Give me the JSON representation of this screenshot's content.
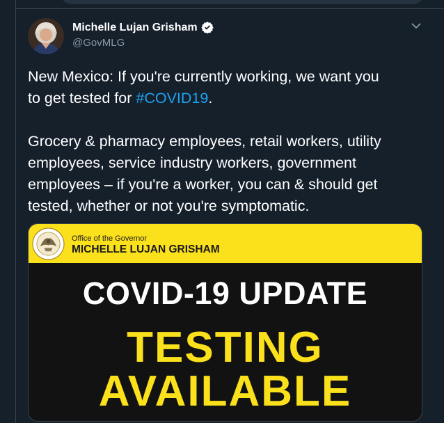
{
  "tweet": {
    "author_name": "Michelle Lujan Grisham",
    "author_handle": "@GovMLG",
    "line1_pre": "New Mexico: If you're currently working, we want you",
    "line2_pre": "to get tested for ",
    "hashtag": "#COVID19",
    "line2_post": ".",
    "para2": [
      "Grocery & pharmacy employees, retail workers, utility",
      "employees, service industry workers, government",
      "employees – if you're a worker, you can & should get",
      "tested, whether or not you're symptomatic."
    ]
  },
  "card": {
    "office_label": "Office of the Governor",
    "governor_name": "MICHELLE LUJAN GRISHAM",
    "headline": "COVID-19 UPDATE",
    "big_line1": "TESTING",
    "big_line2": "AVAILABLE"
  },
  "icons": {
    "verified": "verified-badge-icon",
    "caret": "chevron-down-icon",
    "seal": "state-seal-icon"
  },
  "colors": {
    "background": "#15202b",
    "hashtag": "#1da1f2",
    "banner_yellow": "#fbe01c",
    "card_dark": "#121212",
    "muted": "#8899a6"
  }
}
